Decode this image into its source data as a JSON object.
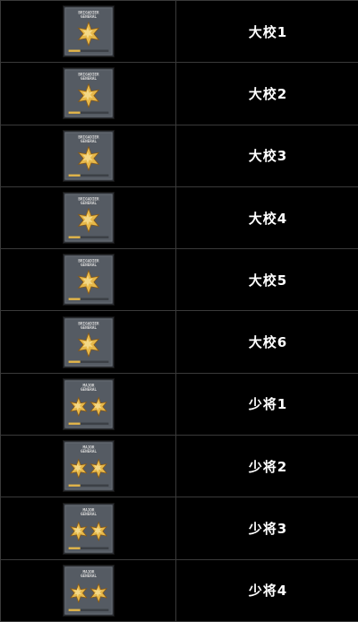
{
  "ranks": [
    {
      "name": "大校1",
      "insignia_text": [
        "BRIGADIER",
        "GENERAL"
      ],
      "stars": 1
    },
    {
      "name": "大校2",
      "insignia_text": [
        "BRIGADIER",
        "GENERAL"
      ],
      "stars": 1
    },
    {
      "name": "大校3",
      "insignia_text": [
        "BRIGADIER",
        "GENERAL"
      ],
      "stars": 1
    },
    {
      "name": "大校4",
      "insignia_text": [
        "BRIGADIER",
        "GENERAL"
      ],
      "stars": 1
    },
    {
      "name": "大校5",
      "insignia_text": [
        "BRIGADIER",
        "GENERAL"
      ],
      "stars": 1
    },
    {
      "name": "大校6",
      "insignia_text": [
        "BRIGADIER",
        "GENERAL"
      ],
      "stars": 1
    },
    {
      "name": "少将1",
      "insignia_text": [
        "MAJOR",
        "GENERAL"
      ],
      "stars": 2
    },
    {
      "name": "少将2",
      "insignia_text": [
        "MAJOR",
        "GENERAL"
      ],
      "stars": 2
    },
    {
      "name": "少将3",
      "insignia_text": [
        "MAJOR",
        "GENERAL"
      ],
      "stars": 2
    },
    {
      "name": "少将4",
      "insignia_text": [
        "MAJOR",
        "GENERAL"
      ],
      "stars": 2
    }
  ],
  "colors": {
    "badge_bg": "#555b63",
    "badge_frame": "#2b2e33",
    "star_gold": "#e6b84a",
    "star_gold_dark": "#8a5a14",
    "star_highlight": "#fff2b8",
    "label_text": "#ffffff",
    "grid_line": "#3a3a3a"
  },
  "icons": {
    "badge": "rank-insignia-icon",
    "star": "gold-star-icon"
  }
}
